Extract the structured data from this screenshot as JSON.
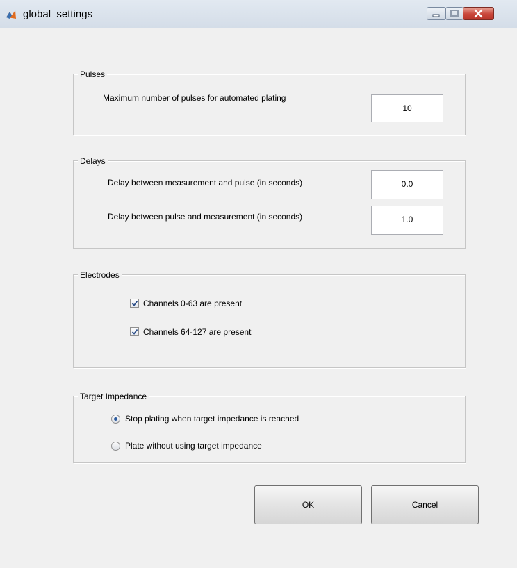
{
  "window": {
    "title": "global_settings",
    "icon": "matlab-icon"
  },
  "pulses": {
    "title": "Pulses",
    "max_pulses_label": "Maximum number of pulses for automated plating",
    "max_pulses_value": "10"
  },
  "delays": {
    "title": "Delays",
    "meas_to_pulse_label": "Delay between measurement and pulse (in seconds)",
    "meas_to_pulse_value": "0.0",
    "pulse_to_meas_label": "Delay between pulse and measurement (in seconds)",
    "pulse_to_meas_value": "1.0"
  },
  "electrodes": {
    "title": "Electrodes",
    "ch_0_63_label": "Channels 0-63 are present",
    "ch_0_63_checked": true,
    "ch_64_127_label": "Channels 64-127 are present",
    "ch_64_127_checked": true
  },
  "target_impedance": {
    "title": "Target Impedance",
    "option_stop_label": "Stop plating when target impedance is reached",
    "option_plate_label": "Plate without using target impedance",
    "selected": "stop"
  },
  "buttons": {
    "ok_label": "OK",
    "cancel_label": "Cancel"
  },
  "colors": {
    "radio_dot": "#2c5b9e",
    "close_button": "#c9463a"
  }
}
